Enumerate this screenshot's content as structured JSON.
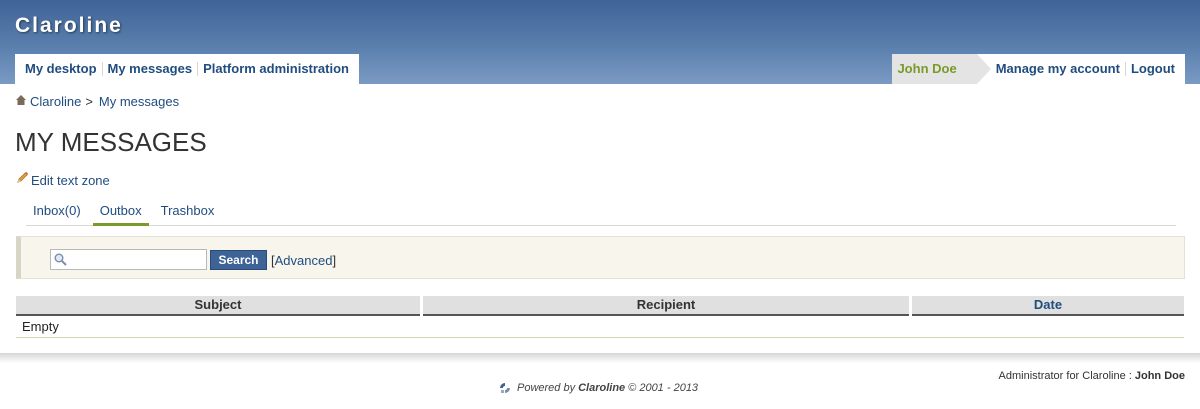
{
  "header": {
    "site_title": "Claroline",
    "nav_left": [
      "My desktop",
      "My messages",
      "Platform administration"
    ],
    "user_name": "John Doe",
    "nav_right": [
      "Manage my account",
      "Logout"
    ]
  },
  "breadcrumb": {
    "home": "Claroline",
    "separator": ">",
    "current": "My messages"
  },
  "page_title": "MY MESSAGES",
  "edit_zone_label": "Edit text zone",
  "tabs": [
    {
      "label": "Inbox(0)",
      "active": false
    },
    {
      "label": "Outbox",
      "active": true
    },
    {
      "label": "Trashbox",
      "active": false
    }
  ],
  "search": {
    "placeholder": "",
    "button_label": "Search",
    "advanced_open": "[",
    "advanced_label": "Advanced",
    "advanced_close": "]"
  },
  "table": {
    "columns": [
      "Subject",
      "Recipient",
      "Date"
    ],
    "empty_text": "Empty"
  },
  "footer": {
    "admin_prefix": "Administrator for Claroline :",
    "admin_name": "John Doe",
    "powered_prefix": "Powered by",
    "powered_brand": "Claroline",
    "powered_suffix": "© 2001 - 2013"
  },
  "colors": {
    "header_top": "#3e6396",
    "link": "#204d80",
    "active_tab": "#7a9a2a",
    "user_name": "#7a9a2a"
  }
}
